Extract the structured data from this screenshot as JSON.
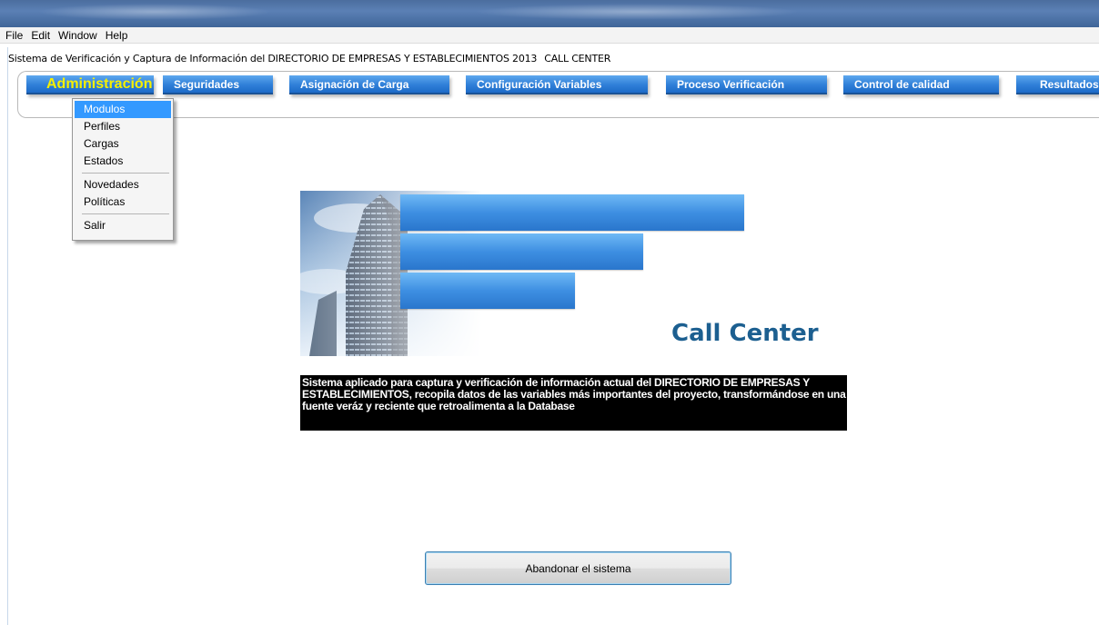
{
  "menubar": {
    "items": [
      "File",
      "Edit",
      "Window",
      "Help"
    ]
  },
  "app": {
    "title_part1": "Sistema de Verificación y Captura de Información del DIRECTORIO DE EMPRESAS Y ESTABLECIMIENTOS 2013",
    "title_part2": "CALL CENTER"
  },
  "tabs": [
    {
      "label": "Administración",
      "active": true
    },
    {
      "label": "Seguridades"
    },
    {
      "label": "Asignación de Carga"
    },
    {
      "label": "Configuración Variables"
    },
    {
      "label": "Proceso Verificación"
    },
    {
      "label": "Control de calidad"
    },
    {
      "label": "Resultados"
    }
  ],
  "dropdown": {
    "items": [
      "Modulos",
      "Perfiles",
      "Cargas",
      "Estados",
      "Novedades",
      "Políticas",
      "Salir"
    ],
    "selected": "Modulos"
  },
  "banner": {
    "heading": "Call Center",
    "description": "Sistema aplicado para captura y verificación de información actual del DIRECTORIO DE EMPRESAS Y ESTABLECIMIENTOS, recopila datos de las variables más importantes del proyecto, transformándose en una fuente veráz y reciente que retroalimenta a la Database"
  },
  "buttons": {
    "exit_label": "Abandonar el sistema"
  },
  "colors": {
    "tab_blue": "#2f7fd8",
    "active_tab_text": "#f6f000",
    "heading": "#1c5f90",
    "menu_highlight": "#3399ff"
  }
}
